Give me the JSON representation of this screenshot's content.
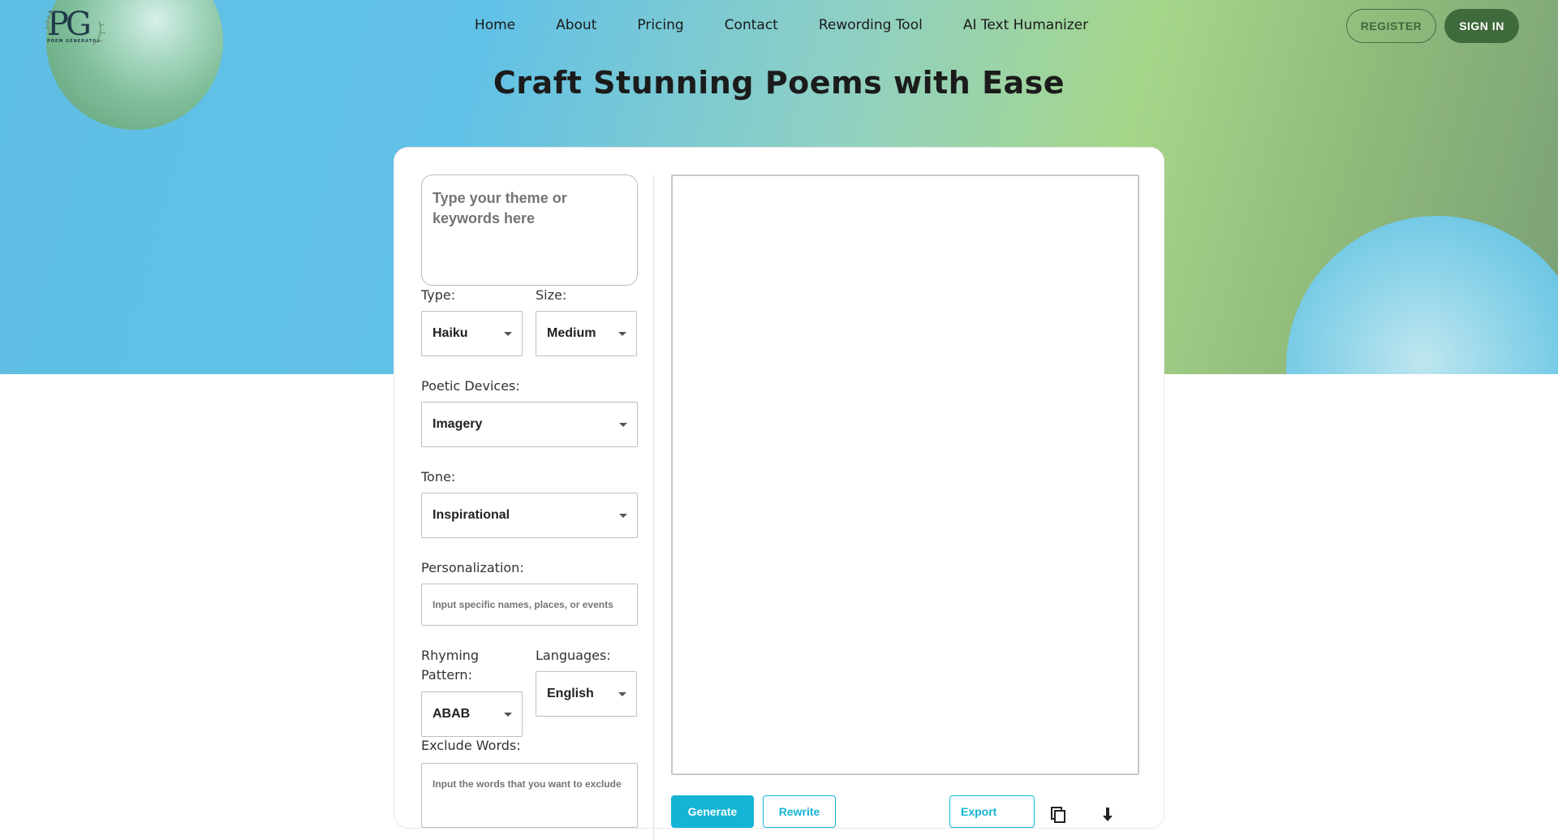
{
  "header": {
    "logo_text": "PG",
    "logo_subtitle": "POEM GENERATOR",
    "nav": [
      {
        "label": "Home"
      },
      {
        "label": "About"
      },
      {
        "label": "Pricing"
      },
      {
        "label": "Contact"
      },
      {
        "label": "Rewording Tool"
      },
      {
        "label": "AI Text Humanizer"
      }
    ],
    "register_label": "REGISTER",
    "signin_label": "SIGN IN"
  },
  "hero": {
    "title": "Craft Stunning Poems with Ease"
  },
  "form": {
    "theme_placeholder": "Type your theme or keywords here",
    "type": {
      "label": "Type:",
      "value": "Haiku"
    },
    "size": {
      "label": "Size:",
      "value": "Medium"
    },
    "poetic_devices": {
      "label": "Poetic Devices:",
      "value": "Imagery"
    },
    "tone": {
      "label": "Tone:",
      "value": "Inspirational"
    },
    "personalization": {
      "label": "Personalization:",
      "placeholder": "Input specific names, places, or events"
    },
    "rhyming_pattern": {
      "label": "Rhyming Pattern:",
      "value": "ABAB"
    },
    "languages": {
      "label": "Languages:",
      "value": "English"
    },
    "exclude_words": {
      "label": "Exclude Words:",
      "placeholder": "Input the words that you want to exclude"
    }
  },
  "actions": {
    "generate_label": "Generate",
    "rewrite_label": "Rewrite",
    "export_label": "Export",
    "icons": [
      "copy-icon",
      "download-icon"
    ]
  },
  "colors": {
    "accent": "#13b4d4",
    "brand_green": "#3f6a3c"
  }
}
